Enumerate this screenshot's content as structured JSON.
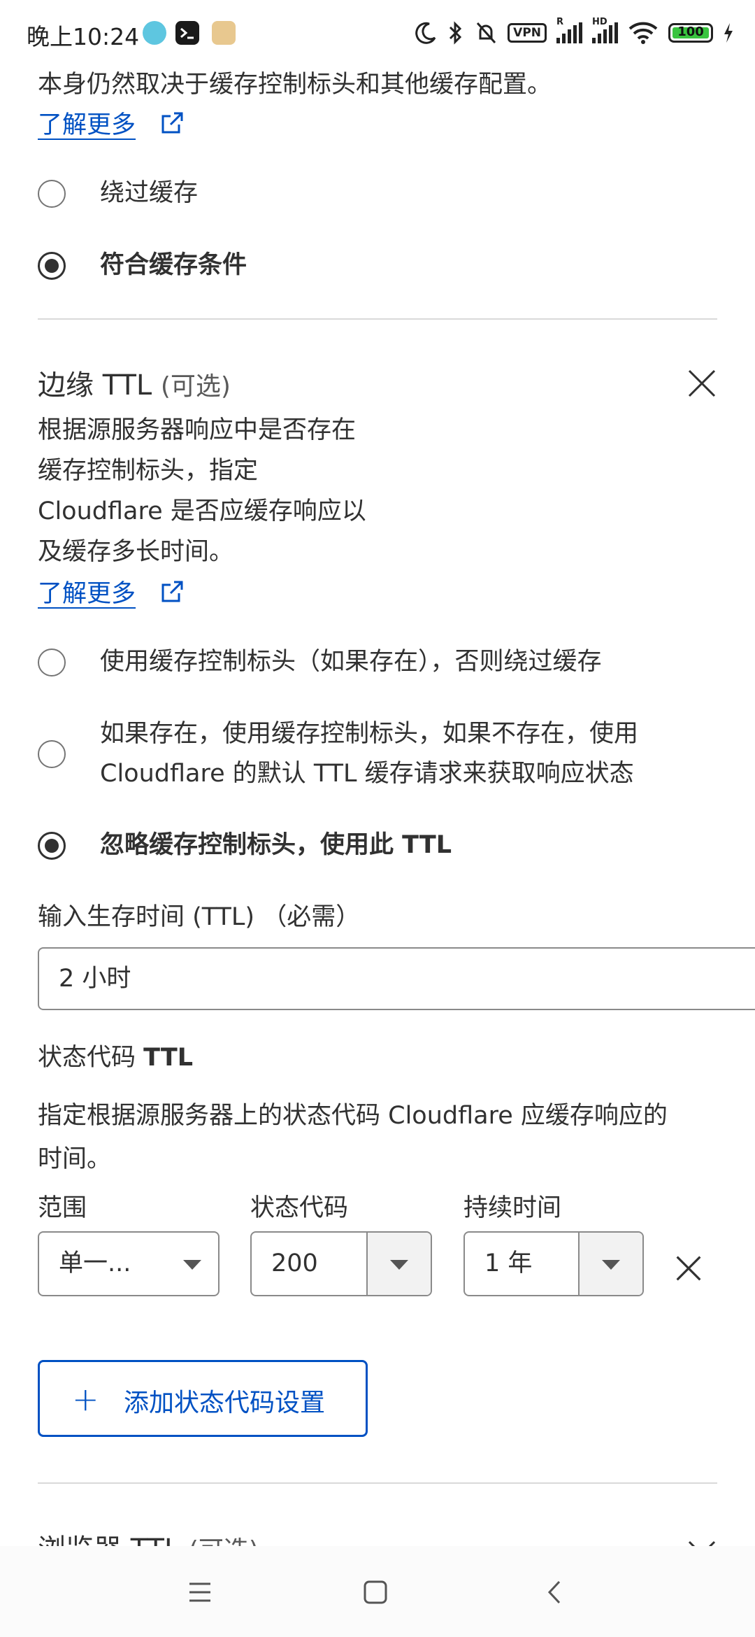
{
  "status_bar": {
    "time": "晚上10:24",
    "vpn": "VPN",
    "battery": "100",
    "network_small_1": "R",
    "network_small_2": "HD"
  },
  "intro": {
    "text": "本身仍然取决于缓存控制标头和其他缓存配置。",
    "learn_more": "了解更多"
  },
  "cache_eligibility": {
    "options": [
      {
        "label": "绕过缓存",
        "checked": false
      },
      {
        "label": "符合缓存条件",
        "checked": true
      }
    ]
  },
  "edge_ttl": {
    "title": "边缘 TTL",
    "optional": "(可选)",
    "description_lines": [
      "根据源服务器响应中是否存在",
      "缓存控制标头，指定",
      "Cloudflare 是否应缓存响应以",
      "及缓存多长时间。"
    ],
    "learn_more": "了解更多",
    "options": [
      {
        "label": "使用缓存控制标头（如果存在），否则绕过缓存",
        "checked": false
      },
      {
        "label_line1": "如果存在，使用缓存控制标头，如果不存在，使用",
        "label_line2": "Cloudflare 的默认 TTL 缓存请求来获取响应状态",
        "checked": false
      },
      {
        "label": "忽略缓存控制标头，使用此 TTL",
        "checked": true
      }
    ],
    "ttl_input_label": "输入生存时间 (TTL) （必需）",
    "ttl_input_value": "2 小时"
  },
  "status_code_ttl": {
    "title_prefix": "状态代码 ",
    "title_bold": "TTL",
    "description_line1": "指定根据源服务器上的状态代码 Cloudflare 应缓存响应的",
    "description_line2": "时间。",
    "range_label": "范围",
    "range_value": "单一...",
    "code_label": "状态代码",
    "code_value": "200",
    "duration_label": "持续时间",
    "duration_value": "1 年",
    "add_button": "添加状态代码设置",
    "add_icon": "+"
  },
  "browser_ttl": {
    "title": "浏览器 TTL",
    "optional": "(可选)"
  },
  "nav_bar": {
    "icons": [
      "menu-icon",
      "home-square-icon",
      "back-chevron-icon"
    ]
  },
  "colors": {
    "accent": "#0051c3",
    "text": "#313131",
    "battery": "#39c43f"
  }
}
